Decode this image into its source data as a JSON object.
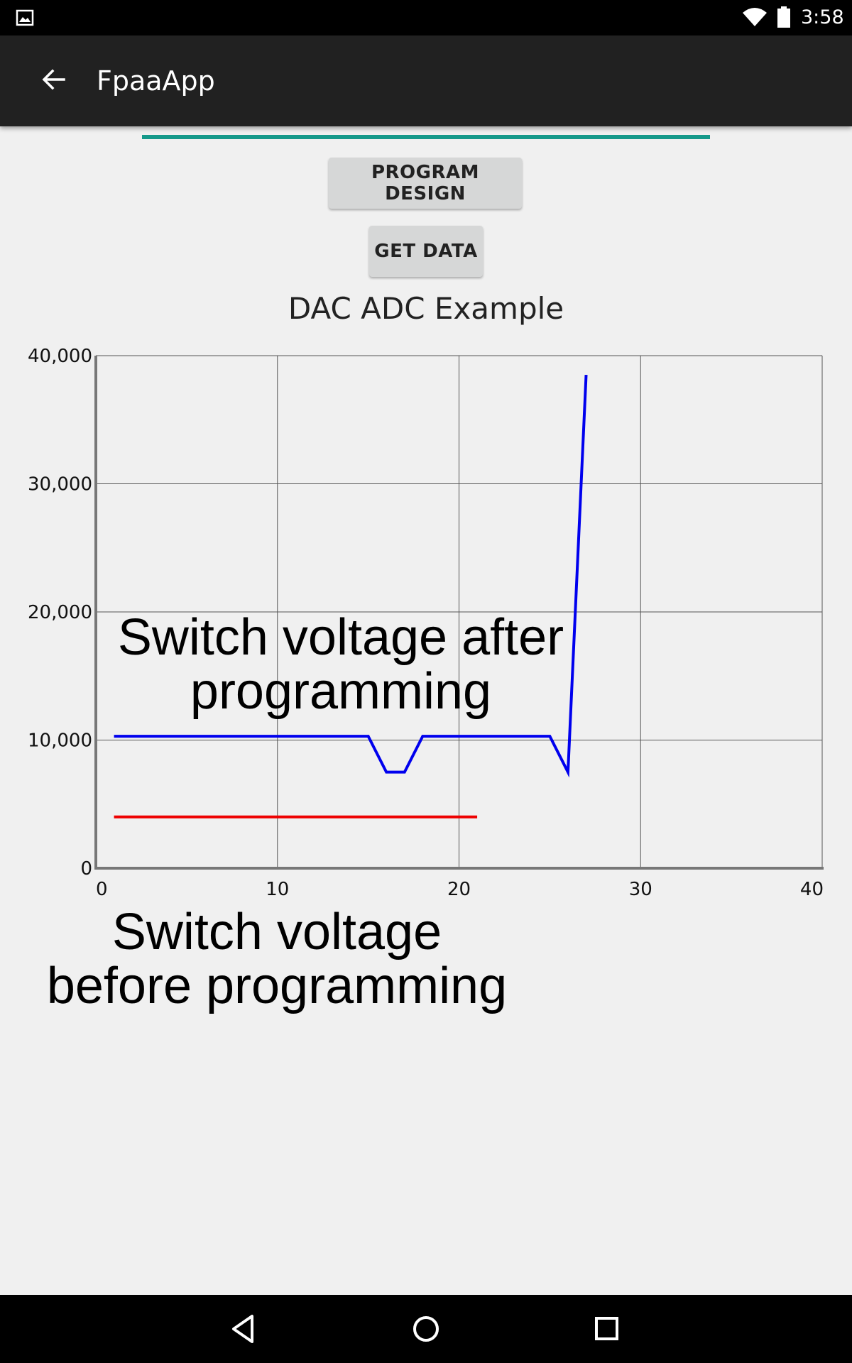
{
  "status_bar": {
    "time": "3:58",
    "icons": [
      "image-icon",
      "wifi-icon",
      "battery-icon"
    ]
  },
  "app_bar": {
    "title": "FpaaApp",
    "back_icon": "arrow-back-icon"
  },
  "buttons": {
    "program_design": "PROGRAM DESIGN",
    "get_data": "GET DATA"
  },
  "annotations": {
    "after": [
      "Switch voltage after",
      "programming"
    ],
    "before": [
      "Switch voltage",
      "before programming"
    ]
  },
  "colors": {
    "accent": "#15998a",
    "app_bar": "#212121",
    "button": "#d6d7d7",
    "series_after": "#0000ee",
    "series_before": "#ee0000"
  },
  "chart_data": {
    "type": "line",
    "title": "DAC ADC Example",
    "xlabel": "",
    "ylabel": "",
    "xlim": [
      0,
      40
    ],
    "ylim": [
      0,
      40000
    ],
    "x_ticks": [
      "0",
      "10",
      "20",
      "30",
      "40"
    ],
    "y_ticks": [
      "0",
      "10,000",
      "20,000",
      "30,000",
      "40,000"
    ],
    "grid": true,
    "series": [
      {
        "color": "#0000ee",
        "x": [
          1,
          2,
          3,
          4,
          5,
          6,
          7,
          8,
          9,
          10,
          11,
          12,
          13,
          14,
          15,
          16,
          17,
          18,
          19,
          20,
          21,
          22,
          23,
          24,
          25,
          26,
          27
        ],
        "y": [
          10300,
          10300,
          10300,
          10300,
          10300,
          10300,
          10300,
          10300,
          10300,
          10300,
          10300,
          10300,
          10300,
          10300,
          10300,
          7500,
          7500,
          10300,
          10300,
          10300,
          10300,
          10300,
          10300,
          10300,
          10300,
          7500,
          38500
        ]
      },
      {
        "color": "#ee0000",
        "x": [
          1,
          2,
          3,
          4,
          5,
          6,
          7,
          8,
          9,
          10,
          11,
          12,
          13,
          14,
          15,
          16,
          17,
          18,
          19,
          20,
          21
        ],
        "y": [
          4000,
          4000,
          4000,
          4000,
          4000,
          4000,
          4000,
          4000,
          4000,
          4000,
          4000,
          4000,
          4000,
          4000,
          4000,
          4000,
          4000,
          4000,
          4000,
          4000,
          4000
        ]
      }
    ]
  }
}
